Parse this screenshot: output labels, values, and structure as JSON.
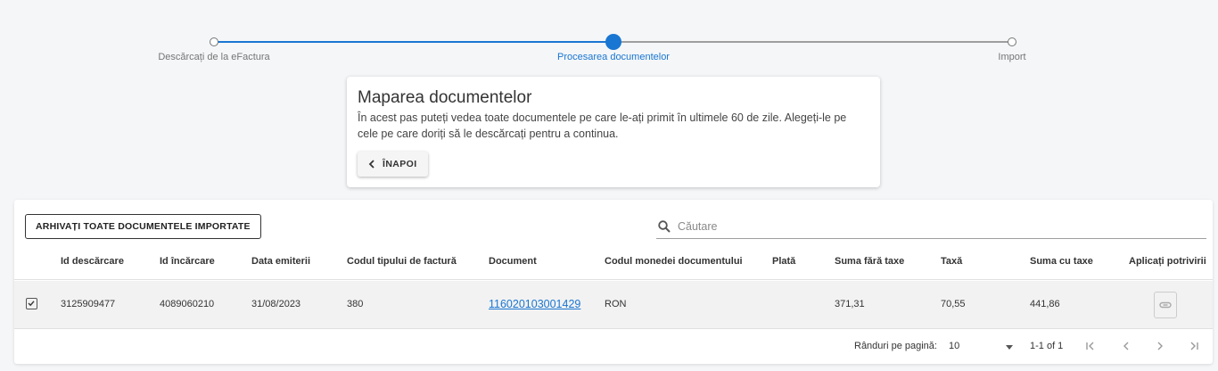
{
  "stepper": {
    "steps": [
      {
        "label": "Descărcați de la eFactura",
        "state": "done"
      },
      {
        "label": "Procesarea documentelor",
        "state": "active"
      },
      {
        "label": "Import",
        "state": "todo"
      }
    ]
  },
  "info": {
    "title": "Maparea documentelor",
    "description": "În acest pas puteți vedea toate documentele pe care le-ați primit în ultimele 60 de zile. Alegeți-le pe cele pe care doriți să le descărcați pentru a continua.",
    "back_label": "ÎNAPOI"
  },
  "toolbar": {
    "archive_label": "ARHIVAȚI TOATE DOCUMENTELE IMPORTATE",
    "search_placeholder": "Căutare"
  },
  "table": {
    "headers": [
      "Id descărcare",
      "Id încărcare",
      "Data emiterii",
      "Codul tipului de factură",
      "Document",
      "Codul monedei documentului",
      "Plată",
      "Suma fără taxe",
      "Taxă",
      "Suma cu taxe",
      "Aplicați potrivirii"
    ],
    "rows": [
      {
        "id_download": "3125909477",
        "id_upload": "4089060210",
        "issue_date": "31/08/2023",
        "invoice_type": "380",
        "document": "116020103001429",
        "currency": "RON",
        "payment": "",
        "amount_no_tax": "371,31",
        "tax": "70,55",
        "amount_with_tax": "441,86"
      }
    ]
  },
  "pagination": {
    "rows_per_page_label": "Rânduri pe pagină:",
    "rows_per_page_value": "10",
    "range": "1-1 of 1"
  },
  "colors": {
    "accent": "#1976d2",
    "background": "#f4f6f8"
  }
}
